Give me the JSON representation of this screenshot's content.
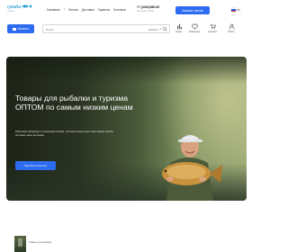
{
  "logo": {
    "brand": "rybalka",
    "tagline": "оптом",
    "icon": "fish-logo-icon"
  },
  "nav": {
    "items": [
      "Компания",
      "Оплата",
      "Доставка",
      "Гарантия",
      "Контакты"
    ]
  },
  "contacts": {
    "phone": "+7 (4342)480-82",
    "note": "бесплатно по РФ"
  },
  "header": {
    "callback_label": "Заказать звонок",
    "lang": "RU"
  },
  "catalog": {
    "label": "Каталог"
  },
  "search": {
    "placeholder": "Поиск",
    "category": "Каталог"
  },
  "icons": [
    {
      "name": "compare-icon",
      "label": "Сравн."
    },
    {
      "name": "favorite-icon",
      "label": "Избранное"
    },
    {
      "name": "cart-icon",
      "label": "Корзина"
    },
    {
      "name": "account-icon",
      "label": "Войти"
    }
  ],
  "hero": {
    "title": "Товары для рыбалки и туризма ОПТОМ по самым низким ценам",
    "text": "Работаем напрямую с производителями, поэтому можем дать вам самые низкие оптовые цены на рынке",
    "button_label": "Перейти в каталог"
  },
  "footer_item": {
    "caption": "Товары для рыбалки"
  },
  "colors": {
    "accent": "#2d6cf0"
  }
}
